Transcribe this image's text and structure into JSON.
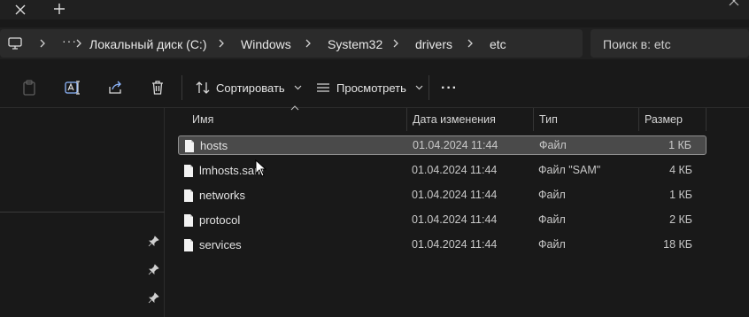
{
  "tabbar": {
    "close_icon": "close-icon",
    "new_tab_icon": "plus-icon"
  },
  "address": {
    "crumbs": [
      "Локальный диск (C:)",
      "Windows",
      "System32",
      "drivers",
      "etc"
    ],
    "overflow": "···"
  },
  "search": {
    "placeholder": "Поиск в: etc"
  },
  "toolbar": {
    "sort_label": "Сортировать",
    "view_label": "Просмотреть",
    "more_label": "···"
  },
  "columns": {
    "name": "Имя",
    "date": "Дата изменения",
    "type": "Тип",
    "size": "Размер"
  },
  "files": [
    {
      "name": "hosts",
      "date": "01.04.2024 11:44",
      "type": "Файл",
      "size": "1 КБ"
    },
    {
      "name": "lmhosts.sam",
      "date": "01.04.2024 11:44",
      "type": "Файл \"SAM\"",
      "size": "4 КБ"
    },
    {
      "name": "networks",
      "date": "01.04.2024 11:44",
      "type": "Файл",
      "size": "1 КБ"
    },
    {
      "name": "protocol",
      "date": "01.04.2024 11:44",
      "type": "Файл",
      "size": "2 КБ"
    },
    {
      "name": "services",
      "date": "01.04.2024 11:44",
      "type": "Файл",
      "size": "18 КБ"
    }
  ],
  "colors": {
    "background": "#191919",
    "chrome": "#202020",
    "selection": "#4a4a4a"
  }
}
